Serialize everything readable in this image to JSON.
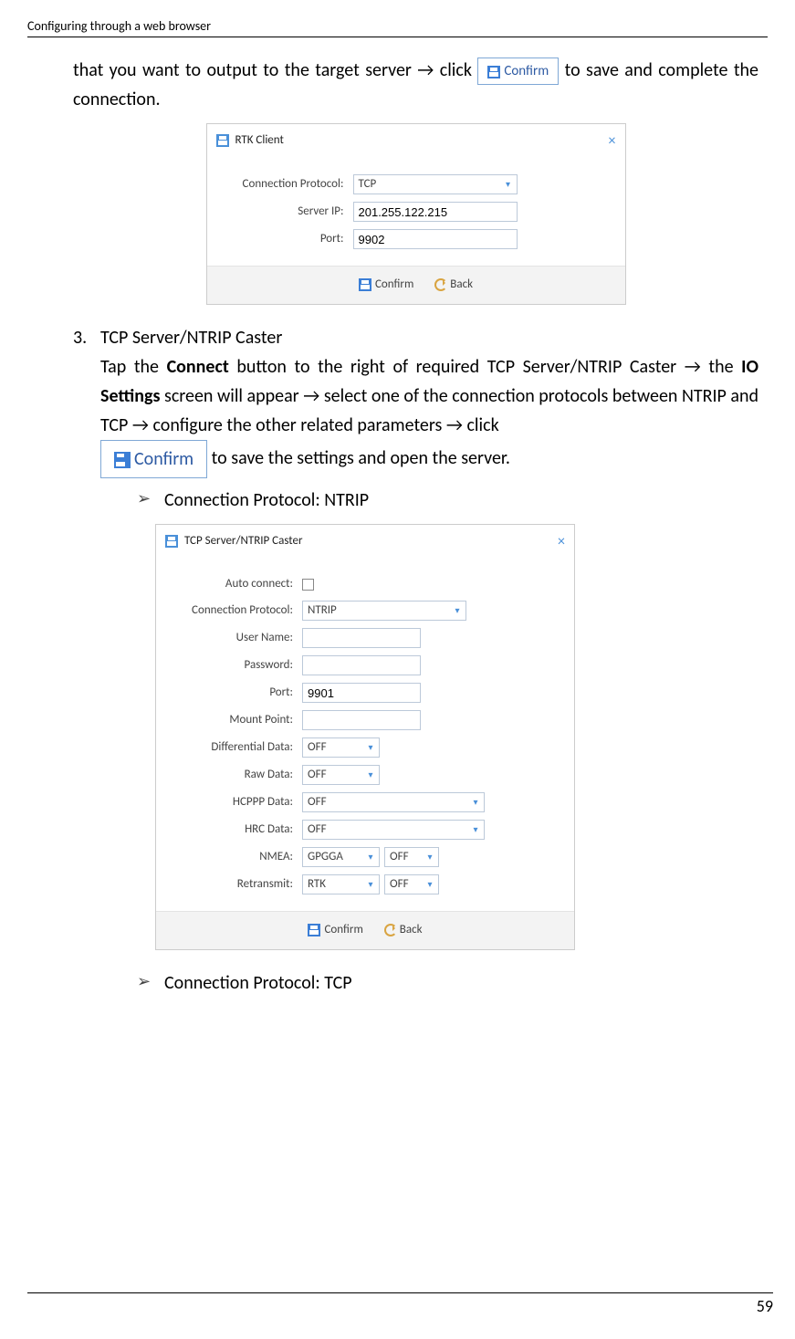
{
  "header": "Configuring through a web browser",
  "para1_part1": "that you want to output to the target server → click ",
  "para1_part2": " to save and complete the connection.",
  "confirm_label": "Confirm",
  "back_label": "Back",
  "dialog1": {
    "title": "RTK Client",
    "rows": {
      "conn_proto_label": "Connection Protocol:",
      "conn_proto_val": "TCP",
      "server_ip_label": "Server IP:",
      "server_ip_val": "201.255.122.215",
      "port_label": "Port:",
      "port_val": "9902"
    }
  },
  "item3": {
    "num": "3.",
    "title": "TCP Server/NTRIP Caster",
    "p1_a": "Tap the ",
    "p1_b": "Connect",
    "p1_c": " button to the right of required TCP Server/NTRIP Caster → the ",
    "p1_d": "IO Settings",
    "p1_e": " screen will appear → select one of the connection protocols between NTRIP and TCP → configure the other related parameters → click ",
    "p1_f": " to save the settings and open the server."
  },
  "bullet1": "Connection Protocol: NTRIP",
  "dialog2": {
    "title": "TCP Server/NTRIP Caster",
    "rows": {
      "auto_connect": "Auto connect:",
      "conn_proto_label": "Connection Protocol:",
      "conn_proto_val": "NTRIP",
      "user_name": "User Name:",
      "password": "Password:",
      "port_label": "Port:",
      "port_val": "9901",
      "mount_point": "Mount Point:",
      "diff_data_label": "Differential Data:",
      "diff_data_val": "OFF",
      "raw_data_label": "Raw Data:",
      "raw_data_val": "OFF",
      "hcppp_label": "HCPPP Data:",
      "hcppp_val": "OFF",
      "hrc_label": "HRC Data:",
      "hrc_val": "OFF",
      "nmea_label": "NMEA:",
      "nmea_val1": "GPGGA",
      "nmea_val2": "OFF",
      "retransmit_label": "Retransmit:",
      "retransmit_val1": "RTK",
      "retransmit_val2": "OFF"
    }
  },
  "bullet2": "Connection Protocol: TCP",
  "page_number": "59"
}
